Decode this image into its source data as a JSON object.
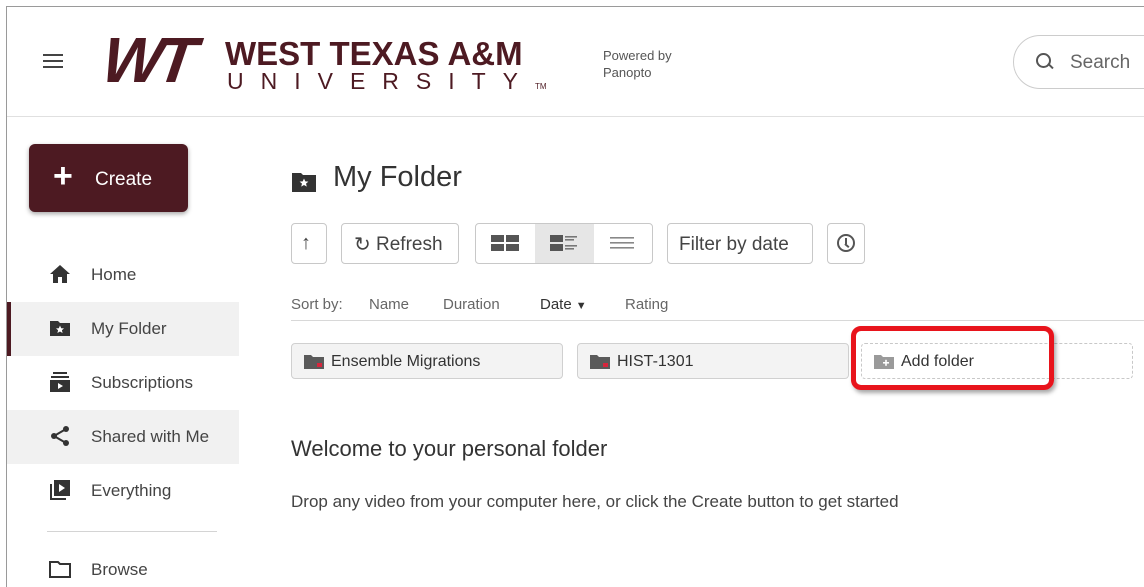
{
  "header": {
    "logo_mark": "WT",
    "logo_line1": "WEST TEXAS A&M",
    "logo_line2": "UNIVERSITY",
    "logo_tm": "TM",
    "powered_line1": "Powered by",
    "powered_line2": "Panopto",
    "search_placeholder": "Search"
  },
  "sidebar": {
    "create_label": "Create",
    "items": [
      {
        "label": "Home",
        "icon": "home-icon"
      },
      {
        "label": "My Folder",
        "icon": "starred-folder-icon",
        "active": true
      },
      {
        "label": "Subscriptions",
        "icon": "subscriptions-icon"
      },
      {
        "label": "Shared with Me",
        "icon": "share-icon"
      },
      {
        "label": "Everything",
        "icon": "everything-icon"
      },
      {
        "label": "Browse",
        "icon": "folder-outline-icon"
      }
    ]
  },
  "main": {
    "title": "My Folder",
    "toolbar": {
      "up_icon": "arrow-up-icon",
      "refresh_label": "Refresh",
      "views": [
        "tile-view",
        "detail-view",
        "list-view"
      ],
      "selected_view": "detail-view",
      "filter_label": "Filter by date",
      "clock_icon": "clock-icon"
    },
    "sort": {
      "label": "Sort by:",
      "options": [
        "Name",
        "Duration",
        "Date",
        "Rating"
      ],
      "active": "Date"
    },
    "folders": [
      {
        "label": "Ensemble Migrations"
      },
      {
        "label": "HIST-1301"
      }
    ],
    "add_folder_label": "Add folder",
    "welcome_title": "Welcome to your personal folder",
    "drop_hint": "Drop any video from your computer here, or click the Create button to get started"
  },
  "colors": {
    "brand": "#4d1a22",
    "highlight": "#e8141c",
    "folder_icon": "#5a5a5a",
    "folder_badge": "#d7263d"
  }
}
